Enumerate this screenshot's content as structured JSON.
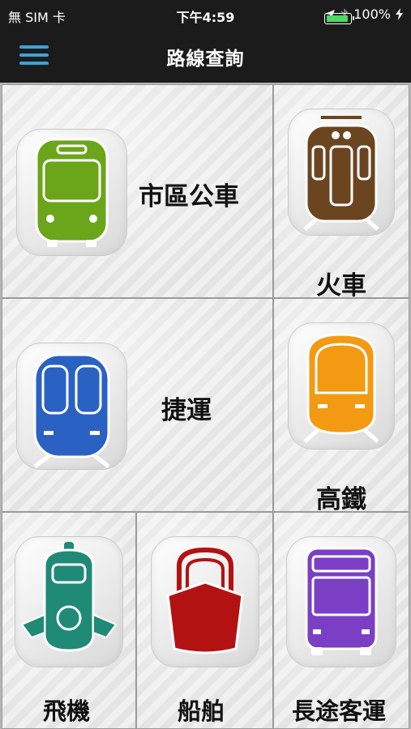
{
  "status_bar": {
    "carrier": "無 SIM 卡",
    "time": "下午4:59",
    "battery": "100%",
    "battery_level": 1.0
  },
  "navbar": {
    "title": "路線查詢",
    "menu_icon": "hamburger-menu-icon"
  },
  "colors": {
    "menu_accent": "#3aa3dc",
    "bus": "#6aa51a",
    "train": "#6b4520",
    "metro": "#2a62c4",
    "hsr": "#f39a12",
    "plane": "#1f8a76",
    "ship": "#b31212",
    "coach": "#7a3fc4"
  },
  "tiles": {
    "bus": {
      "label": "市區公車",
      "icon": "city-bus-icon"
    },
    "train": {
      "label": "火車",
      "icon": "train-icon"
    },
    "metro": {
      "label": "捷運",
      "icon": "metro-icon"
    },
    "hsr": {
      "label": "高鐵",
      "icon": "high-speed-rail-icon"
    },
    "plane": {
      "label": "飛機",
      "icon": "airplane-icon"
    },
    "ship": {
      "label": "船舶",
      "icon": "ship-icon"
    },
    "coach": {
      "label": "長途客運",
      "icon": "coach-bus-icon"
    }
  }
}
